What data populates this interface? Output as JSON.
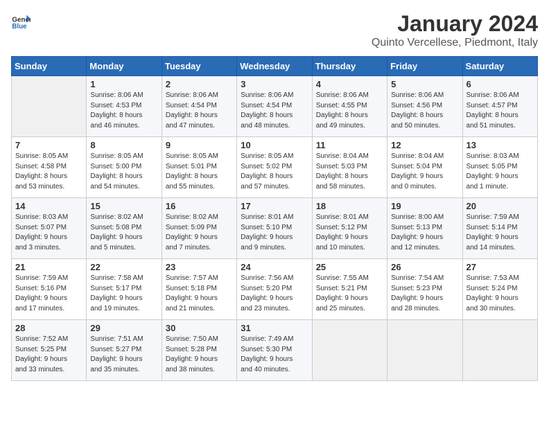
{
  "header": {
    "logo_general": "General",
    "logo_blue": "Blue",
    "month_year": "January 2024",
    "location": "Quinto Vercellese, Piedmont, Italy"
  },
  "days_of_week": [
    "Sunday",
    "Monday",
    "Tuesday",
    "Wednesday",
    "Thursday",
    "Friday",
    "Saturday"
  ],
  "weeks": [
    [
      {
        "day": "",
        "content": ""
      },
      {
        "day": "1",
        "content": "Sunrise: 8:06 AM\nSunset: 4:53 PM\nDaylight: 8 hours\nand 46 minutes."
      },
      {
        "day": "2",
        "content": "Sunrise: 8:06 AM\nSunset: 4:54 PM\nDaylight: 8 hours\nand 47 minutes."
      },
      {
        "day": "3",
        "content": "Sunrise: 8:06 AM\nSunset: 4:54 PM\nDaylight: 8 hours\nand 48 minutes."
      },
      {
        "day": "4",
        "content": "Sunrise: 8:06 AM\nSunset: 4:55 PM\nDaylight: 8 hours\nand 49 minutes."
      },
      {
        "day": "5",
        "content": "Sunrise: 8:06 AM\nSunset: 4:56 PM\nDaylight: 8 hours\nand 50 minutes."
      },
      {
        "day": "6",
        "content": "Sunrise: 8:06 AM\nSunset: 4:57 PM\nDaylight: 8 hours\nand 51 minutes."
      }
    ],
    [
      {
        "day": "7",
        "content": "Sunrise: 8:05 AM\nSunset: 4:58 PM\nDaylight: 8 hours\nand 53 minutes."
      },
      {
        "day": "8",
        "content": "Sunrise: 8:05 AM\nSunset: 5:00 PM\nDaylight: 8 hours\nand 54 minutes."
      },
      {
        "day": "9",
        "content": "Sunrise: 8:05 AM\nSunset: 5:01 PM\nDaylight: 8 hours\nand 55 minutes."
      },
      {
        "day": "10",
        "content": "Sunrise: 8:05 AM\nSunset: 5:02 PM\nDaylight: 8 hours\nand 57 minutes."
      },
      {
        "day": "11",
        "content": "Sunrise: 8:04 AM\nSunset: 5:03 PM\nDaylight: 8 hours\nand 58 minutes."
      },
      {
        "day": "12",
        "content": "Sunrise: 8:04 AM\nSunset: 5:04 PM\nDaylight: 9 hours\nand 0 minutes."
      },
      {
        "day": "13",
        "content": "Sunrise: 8:03 AM\nSunset: 5:05 PM\nDaylight: 9 hours\nand 1 minute."
      }
    ],
    [
      {
        "day": "14",
        "content": "Sunrise: 8:03 AM\nSunset: 5:07 PM\nDaylight: 9 hours\nand 3 minutes."
      },
      {
        "day": "15",
        "content": "Sunrise: 8:02 AM\nSunset: 5:08 PM\nDaylight: 9 hours\nand 5 minutes."
      },
      {
        "day": "16",
        "content": "Sunrise: 8:02 AM\nSunset: 5:09 PM\nDaylight: 9 hours\nand 7 minutes."
      },
      {
        "day": "17",
        "content": "Sunrise: 8:01 AM\nSunset: 5:10 PM\nDaylight: 9 hours\nand 9 minutes."
      },
      {
        "day": "18",
        "content": "Sunrise: 8:01 AM\nSunset: 5:12 PM\nDaylight: 9 hours\nand 10 minutes."
      },
      {
        "day": "19",
        "content": "Sunrise: 8:00 AM\nSunset: 5:13 PM\nDaylight: 9 hours\nand 12 minutes."
      },
      {
        "day": "20",
        "content": "Sunrise: 7:59 AM\nSunset: 5:14 PM\nDaylight: 9 hours\nand 14 minutes."
      }
    ],
    [
      {
        "day": "21",
        "content": "Sunrise: 7:59 AM\nSunset: 5:16 PM\nDaylight: 9 hours\nand 17 minutes."
      },
      {
        "day": "22",
        "content": "Sunrise: 7:58 AM\nSunset: 5:17 PM\nDaylight: 9 hours\nand 19 minutes."
      },
      {
        "day": "23",
        "content": "Sunrise: 7:57 AM\nSunset: 5:18 PM\nDaylight: 9 hours\nand 21 minutes."
      },
      {
        "day": "24",
        "content": "Sunrise: 7:56 AM\nSunset: 5:20 PM\nDaylight: 9 hours\nand 23 minutes."
      },
      {
        "day": "25",
        "content": "Sunrise: 7:55 AM\nSunset: 5:21 PM\nDaylight: 9 hours\nand 25 minutes."
      },
      {
        "day": "26",
        "content": "Sunrise: 7:54 AM\nSunset: 5:23 PM\nDaylight: 9 hours\nand 28 minutes."
      },
      {
        "day": "27",
        "content": "Sunrise: 7:53 AM\nSunset: 5:24 PM\nDaylight: 9 hours\nand 30 minutes."
      }
    ],
    [
      {
        "day": "28",
        "content": "Sunrise: 7:52 AM\nSunset: 5:25 PM\nDaylight: 9 hours\nand 33 minutes."
      },
      {
        "day": "29",
        "content": "Sunrise: 7:51 AM\nSunset: 5:27 PM\nDaylight: 9 hours\nand 35 minutes."
      },
      {
        "day": "30",
        "content": "Sunrise: 7:50 AM\nSunset: 5:28 PM\nDaylight: 9 hours\nand 38 minutes."
      },
      {
        "day": "31",
        "content": "Sunrise: 7:49 AM\nSunset: 5:30 PM\nDaylight: 9 hours\nand 40 minutes."
      },
      {
        "day": "",
        "content": ""
      },
      {
        "day": "",
        "content": ""
      },
      {
        "day": "",
        "content": ""
      }
    ]
  ]
}
